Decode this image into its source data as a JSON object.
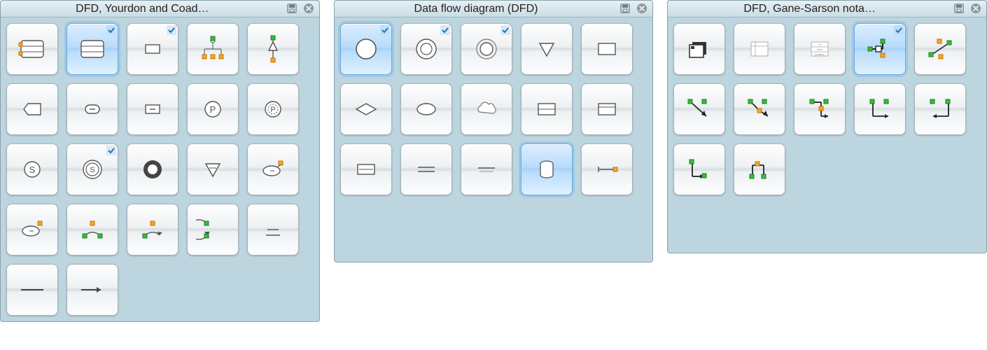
{
  "panels": [
    {
      "id": "yourdon-coad",
      "title": "DFD, Yourdon and Coad…",
      "shapes": [
        {
          "name": "data-store-orange",
          "selected": false,
          "check": false
        },
        {
          "name": "data-store-plain",
          "selected": true,
          "check": true
        },
        {
          "name": "entity-rect-small",
          "selected": false,
          "check": true
        },
        {
          "name": "hierarchy-shape",
          "selected": false,
          "check": false
        },
        {
          "name": "triangle-line-shape",
          "selected": false,
          "check": false
        },
        {
          "name": "hexagon-open",
          "selected": false,
          "check": false
        },
        {
          "name": "rounded-hex-minus",
          "selected": false,
          "check": false
        },
        {
          "name": "rect-minus",
          "selected": false,
          "check": false
        },
        {
          "name": "circle-p",
          "selected": false,
          "check": false
        },
        {
          "name": "circle-p-dashed",
          "selected": false,
          "check": false
        },
        {
          "name": "circle-s",
          "selected": false,
          "check": false
        },
        {
          "name": "circle-s-double",
          "selected": false,
          "check": true
        },
        {
          "name": "ring-bold",
          "selected": false,
          "check": false
        },
        {
          "name": "triangle-down",
          "selected": false,
          "check": false
        },
        {
          "name": "ellipse-handles1",
          "selected": false,
          "check": false
        },
        {
          "name": "ellipse-handles2",
          "selected": false,
          "check": false
        },
        {
          "name": "arc-handles-a",
          "selected": false,
          "check": false
        },
        {
          "name": "arc-handles-b",
          "selected": false,
          "check": false
        },
        {
          "name": "arc-handles-c",
          "selected": false,
          "check": false
        },
        {
          "name": "single-line-seg",
          "selected": false,
          "check": false
        },
        {
          "name": "line-plain",
          "selected": false,
          "check": false
        },
        {
          "name": "line-arrow",
          "selected": false,
          "check": false
        }
      ]
    },
    {
      "id": "dfd",
      "title": "Data flow diagram (DFD)",
      "shapes": [
        {
          "name": "circle-large",
          "selected": true,
          "check": true
        },
        {
          "name": "circle-double",
          "selected": false,
          "check": true
        },
        {
          "name": "circle-ring",
          "selected": false,
          "check": true
        },
        {
          "name": "triangle-down-outline",
          "selected": false,
          "check": false
        },
        {
          "name": "rect-plain",
          "selected": false,
          "check": false
        },
        {
          "name": "diamond",
          "selected": false,
          "check": false
        },
        {
          "name": "ellipse-plain",
          "selected": false,
          "check": false
        },
        {
          "name": "cloud",
          "selected": false,
          "check": false
        },
        {
          "name": "rect-split-h",
          "selected": false,
          "check": false
        },
        {
          "name": "rect-header",
          "selected": false,
          "check": false
        },
        {
          "name": "double-line-box",
          "selected": false,
          "check": false
        },
        {
          "name": "double-line",
          "selected": false,
          "check": false
        },
        {
          "name": "single-line",
          "selected": false,
          "check": false
        },
        {
          "name": "cylinder",
          "selected": true,
          "check": false
        },
        {
          "name": "bracket-line",
          "selected": false,
          "check": false
        }
      ]
    },
    {
      "id": "gane-sarson",
      "title": "DFD, Gane-Sarson nota…",
      "shapes": [
        {
          "name": "entity-3d",
          "selected": false,
          "check": false
        },
        {
          "name": "card-right-open",
          "selected": false,
          "check": false
        },
        {
          "name": "card-labeled",
          "selected": false,
          "check": false
        },
        {
          "name": "connector-angle",
          "selected": true,
          "check": true
        },
        {
          "name": "line-diag-handles",
          "selected": false,
          "check": false
        },
        {
          "name": "conn-a",
          "selected": false,
          "check": false
        },
        {
          "name": "conn-b",
          "selected": false,
          "check": false
        },
        {
          "name": "conn-c",
          "selected": false,
          "check": false
        },
        {
          "name": "conn-d",
          "selected": false,
          "check": false
        },
        {
          "name": "conn-e",
          "selected": false,
          "check": false
        },
        {
          "name": "conn-f",
          "selected": false,
          "check": false
        },
        {
          "name": "conn-g",
          "selected": false,
          "check": false
        }
      ]
    }
  ]
}
